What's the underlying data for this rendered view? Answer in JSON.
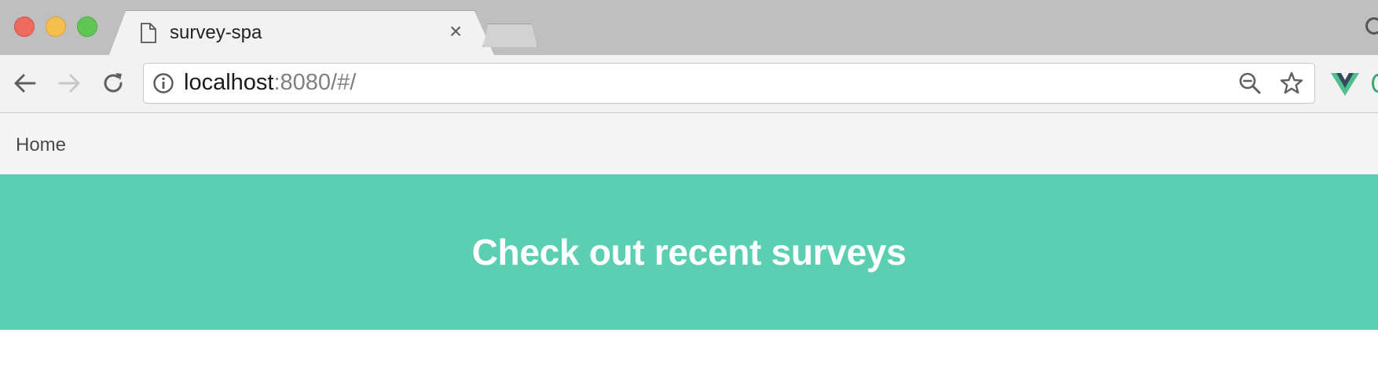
{
  "browser": {
    "tab_title": "survey-spa",
    "close_tab_glyph": "×",
    "url_host": "localhost",
    "url_rest": ":8080/#/",
    "icons": [
      "document-icon",
      "close-icon",
      "back-arrow-icon",
      "forward-arrow-icon",
      "reload-icon",
      "info-icon",
      "zoom-out-icon",
      "bookmark-star-icon",
      "vue-devtools-icon"
    ]
  },
  "page": {
    "nav_home": "Home",
    "hero_title": "Check out recent surveys"
  },
  "colors": {
    "hero_background": "#5ccfb3",
    "navbar_background": "#f5f5f5",
    "chrome_background": "#f2f2f2"
  }
}
